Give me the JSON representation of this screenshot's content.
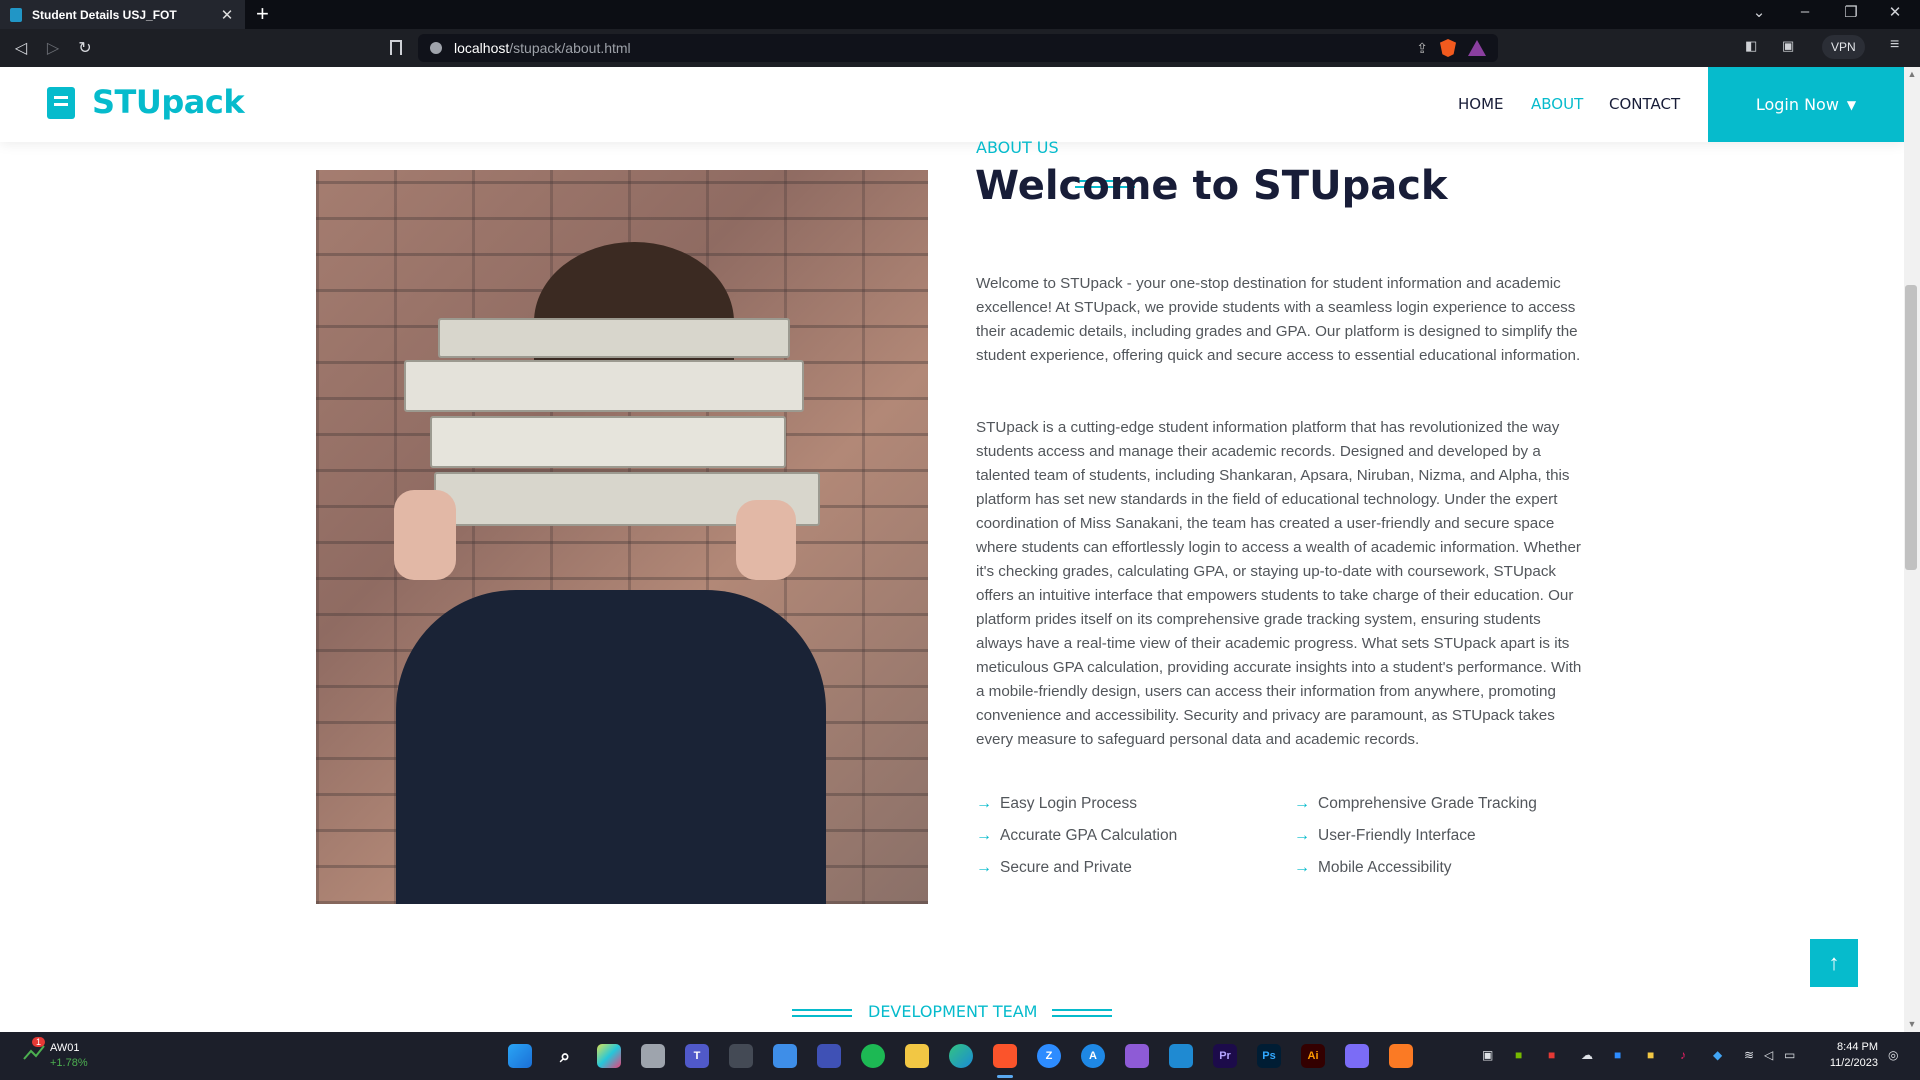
{
  "browser": {
    "tab_title": "Student Details USJ_FOT",
    "url_host": "localhost",
    "url_path": "/stupack/about.html",
    "vpn_label": "VPN"
  },
  "site": {
    "brand": "STUpack",
    "accent_color": "#06bbcc",
    "nav": [
      {
        "label": "HOME",
        "active": false
      },
      {
        "label": "ABOUT",
        "active": true
      },
      {
        "label": "CONTACT",
        "active": false
      }
    ],
    "login_label": "Login Now"
  },
  "about": {
    "tag": "ABOUT US",
    "title": "Welcome to STUpack",
    "para1": "Welcome to STUpack - your one-stop destination for student information and academic excellence! At STUpack, we provide students with a seamless login experience to access their academic details, including grades and GPA. Our platform is designed to simplify the student experience, offering quick and secure access to essential educational information.",
    "para2": "STUpack is a cutting-edge student information platform that has revolutionized the way students access and manage their academic records. Designed and developed by a talented team of students, including Shankaran, Apsara, Niruban, Nizma, and Alpha, this platform has set new standards in the field of educational technology. Under the expert coordination of Miss Sanakani, the team has created a user-friendly and secure space where students can effortlessly login to access a wealth of academic information. Whether it's checking grades, calculating GPA, or staying up-to-date with coursework, STUpack offers an intuitive interface that empowers students to take charge of their education. Our platform prides itself on its comprehensive grade tracking system, ensuring students always have a real-time view of their academic progress. What sets STUpack apart is its meticulous GPA calculation, providing accurate insights into a student's performance. With a mobile-friendly design, users can access their information from anywhere, promoting convenience and accessibility. Security and privacy are paramount, as STUpack takes every measure to safeguard personal data and academic records.",
    "features": [
      "Easy Login Process",
      "Comprehensive Grade Tracking",
      "Accurate GPA Calculation",
      "User-Friendly Interface",
      "Secure and Private",
      "Mobile Accessibility"
    ]
  },
  "team": {
    "tag": "DEVELOPMENT TEAM"
  },
  "taskbar": {
    "stock_name": "AW01",
    "stock_change": "+1.78%",
    "stock_badge": "1",
    "time": "8:44 PM",
    "date": "11/2/2023"
  }
}
